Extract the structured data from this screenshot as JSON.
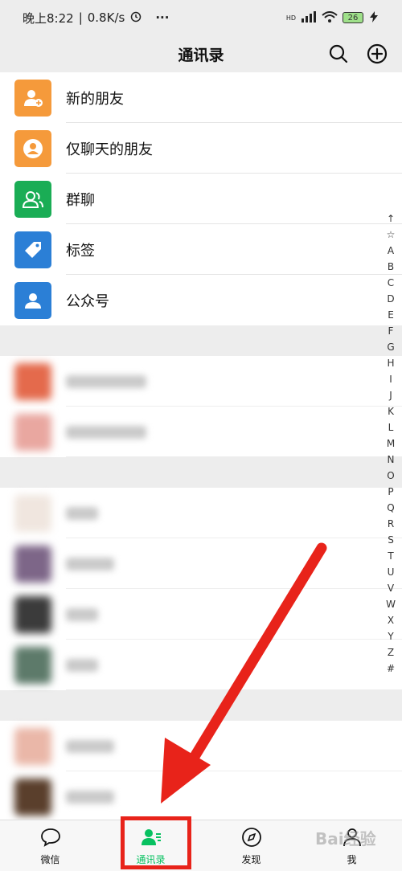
{
  "status_bar": {
    "time": "晚上8:22",
    "speed": "0.8K/s",
    "more": "···",
    "hd": "HD",
    "battery": "26"
  },
  "nav": {
    "title": "通讯录"
  },
  "fixed_items": [
    {
      "label": "新的朋友",
      "color": "#f59a3b",
      "icon": "add-friend-icon"
    },
    {
      "label": "仅聊天的朋友",
      "color": "#f59a3b",
      "icon": "chat-only-friend-icon"
    },
    {
      "label": "群聊",
      "color": "#1aad55",
      "icon": "group-chat-icon"
    },
    {
      "label": "标签",
      "color": "#2b7fd6",
      "icon": "tag-icon"
    },
    {
      "label": "公众号",
      "color": "#2b7fd6",
      "icon": "official-account-icon"
    }
  ],
  "index_letters": [
    "↑",
    "☆",
    "A",
    "B",
    "C",
    "D",
    "E",
    "F",
    "G",
    "H",
    "I",
    "J",
    "K",
    "L",
    "M",
    "N",
    "O",
    "P",
    "Q",
    "R",
    "S",
    "T",
    "U",
    "V",
    "W",
    "X",
    "Y",
    "Z",
    "#"
  ],
  "tabs": [
    {
      "label": "微信",
      "icon": "chat-bubble-icon",
      "active": false
    },
    {
      "label": "通讯录",
      "icon": "contacts-icon",
      "active": true
    },
    {
      "label": "发现",
      "icon": "compass-icon",
      "active": false
    },
    {
      "label": "我",
      "icon": "profile-icon",
      "active": false
    }
  ],
  "watermark": "Bai经验",
  "colors": {
    "accent": "#07c160",
    "annotation": "#e8231a"
  }
}
